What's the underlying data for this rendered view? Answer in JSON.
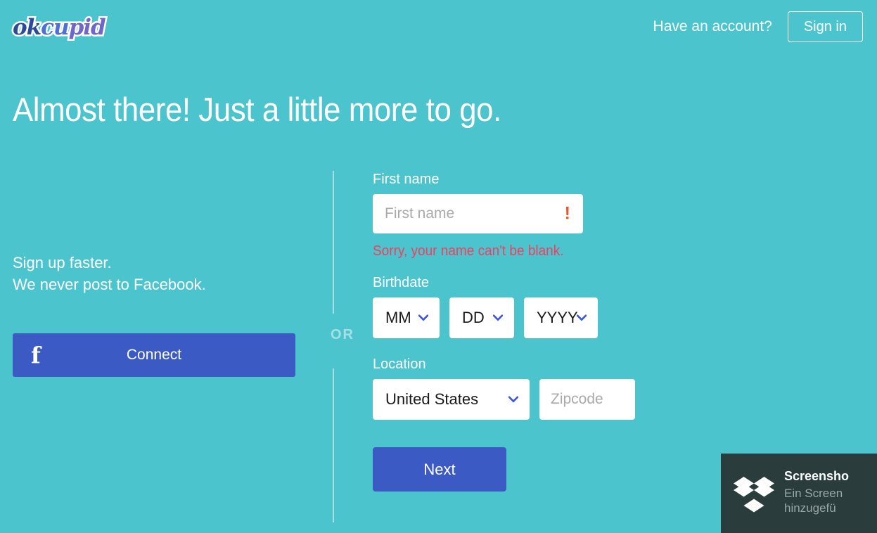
{
  "brand": {
    "logo_ok": "ok",
    "logo_cu": "cu",
    "logo_pid": "pid",
    "teal": "#4cc4ce",
    "facebook_blue": "#3b5ac4",
    "error_red": "#ef4060",
    "warning_orange": "#f8512a",
    "chevron_blue": "#3d54d8"
  },
  "header": {
    "have_account_text": "Have an account?",
    "sign_in_label": "Sign in"
  },
  "headline": "Almost there! Just a little more to go.",
  "facebook": {
    "pitch_line1": "Sign up faster.",
    "pitch_line2": "We never post to Facebook.",
    "icon": "facebook-f-icon",
    "connect_label": "Connect"
  },
  "divider": {
    "or_label": "OR"
  },
  "form": {
    "first_name": {
      "label": "First name",
      "placeholder": "First name",
      "value": "",
      "error_icon": "exclamation-icon",
      "error_message": "Sorry, your name can't be blank."
    },
    "birthdate": {
      "label": "Birthdate",
      "month": {
        "value": "MM",
        "options": [
          "MM"
        ]
      },
      "day": {
        "value": "DD",
        "options": [
          "DD"
        ]
      },
      "year": {
        "value": "YYYY",
        "options": [
          "YYYY"
        ]
      }
    },
    "location": {
      "label": "Location",
      "country": {
        "value": "United States",
        "options": [
          "United States"
        ]
      },
      "zipcode": {
        "placeholder": "Zipcode",
        "value": ""
      }
    },
    "next_label": "Next"
  },
  "toast": {
    "icon": "dropbox-icon",
    "title": "Screensho",
    "line1": "Ein Screen",
    "line2": "hinzugefü"
  }
}
